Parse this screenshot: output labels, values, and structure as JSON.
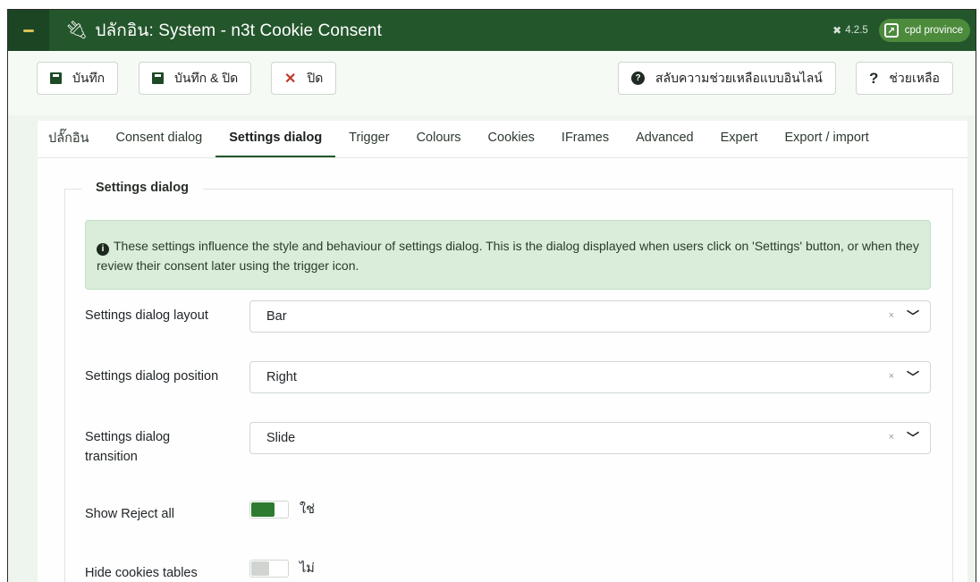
{
  "header": {
    "title": "ปลักอิน: System - n3t Cookie Consent",
    "version": "4.2.5",
    "site_name": "cpd province",
    "icons": {
      "logo": "joomla-logo",
      "plugin": "plug-icon",
      "version": "joomla-icon",
      "site": "external-link-icon"
    }
  },
  "toolbar": {
    "save_label": "บันทึก",
    "save_close_label": "บันทึก & ปิด",
    "close_label": "ปิด",
    "toggle_help_label": "สลับความช่วยเหลือแบบอินไลน์",
    "help_label": "ช่วยเหลือ"
  },
  "tabs": [
    {
      "label": "ปลั๊กอิน",
      "active": false
    },
    {
      "label": "Consent dialog",
      "active": false
    },
    {
      "label": "Settings dialog",
      "active": true
    },
    {
      "label": "Trigger",
      "active": false
    },
    {
      "label": "Colours",
      "active": false
    },
    {
      "label": "Cookies",
      "active": false
    },
    {
      "label": "IFrames",
      "active": false
    },
    {
      "label": "Advanced",
      "active": false
    },
    {
      "label": "Expert",
      "active": false
    },
    {
      "label": "Export / import",
      "active": false
    }
  ],
  "fieldset": {
    "legend": "Settings dialog",
    "info_text": "These settings influence the style and behaviour of settings dialog. This is the dialog displayed when users click on 'Settings' button, or when they review their consent later using the trigger icon."
  },
  "fields": {
    "layout": {
      "label": "Settings dialog layout",
      "value": "Bar"
    },
    "position": {
      "label": "Settings dialog position",
      "value": "Right"
    },
    "transition": {
      "label": "Settings dialog transition",
      "value": "Slide"
    },
    "show_reject_all": {
      "label": "Show Reject all",
      "value": "ใช่",
      "on": true
    },
    "hide_cookies_tables": {
      "label": "Hide cookies tables",
      "value": "ไม่",
      "on": false
    }
  },
  "colors": {
    "header_bg": "#24562c",
    "accent": "#2d7a31",
    "alert_bg": "#d9edda"
  }
}
